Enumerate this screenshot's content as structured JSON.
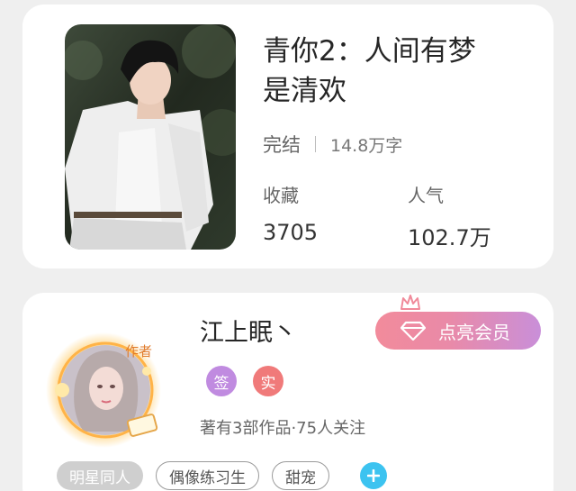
{
  "book": {
    "title_line1": "青你2：人间有梦",
    "title_line2": "是清欢",
    "status": "完结",
    "word_count": "14.8万字",
    "favorites_label": "收藏",
    "favorites_value": "3705",
    "popularity_label": "人气",
    "popularity_value": "102.7万"
  },
  "author": {
    "name": "江上眠丶",
    "avatar_tag": "作者",
    "badge_signed": "签",
    "badge_verified": "实",
    "works_info": "著有3部作品·75人关注",
    "vip_button": "点亮会员"
  },
  "tags": [
    "明星同人",
    "偶像练习生",
    "甜宠"
  ],
  "colors": {
    "vip_gradient_start": "#f28b9b",
    "vip_gradient_end": "#c98fd9",
    "badge_signed": "#c08be0",
    "badge_verified": "#f07a7a",
    "add_tag": "#3cc3f0"
  },
  "icons": [
    "crown-icon",
    "diamond-icon",
    "plus-icon"
  ]
}
